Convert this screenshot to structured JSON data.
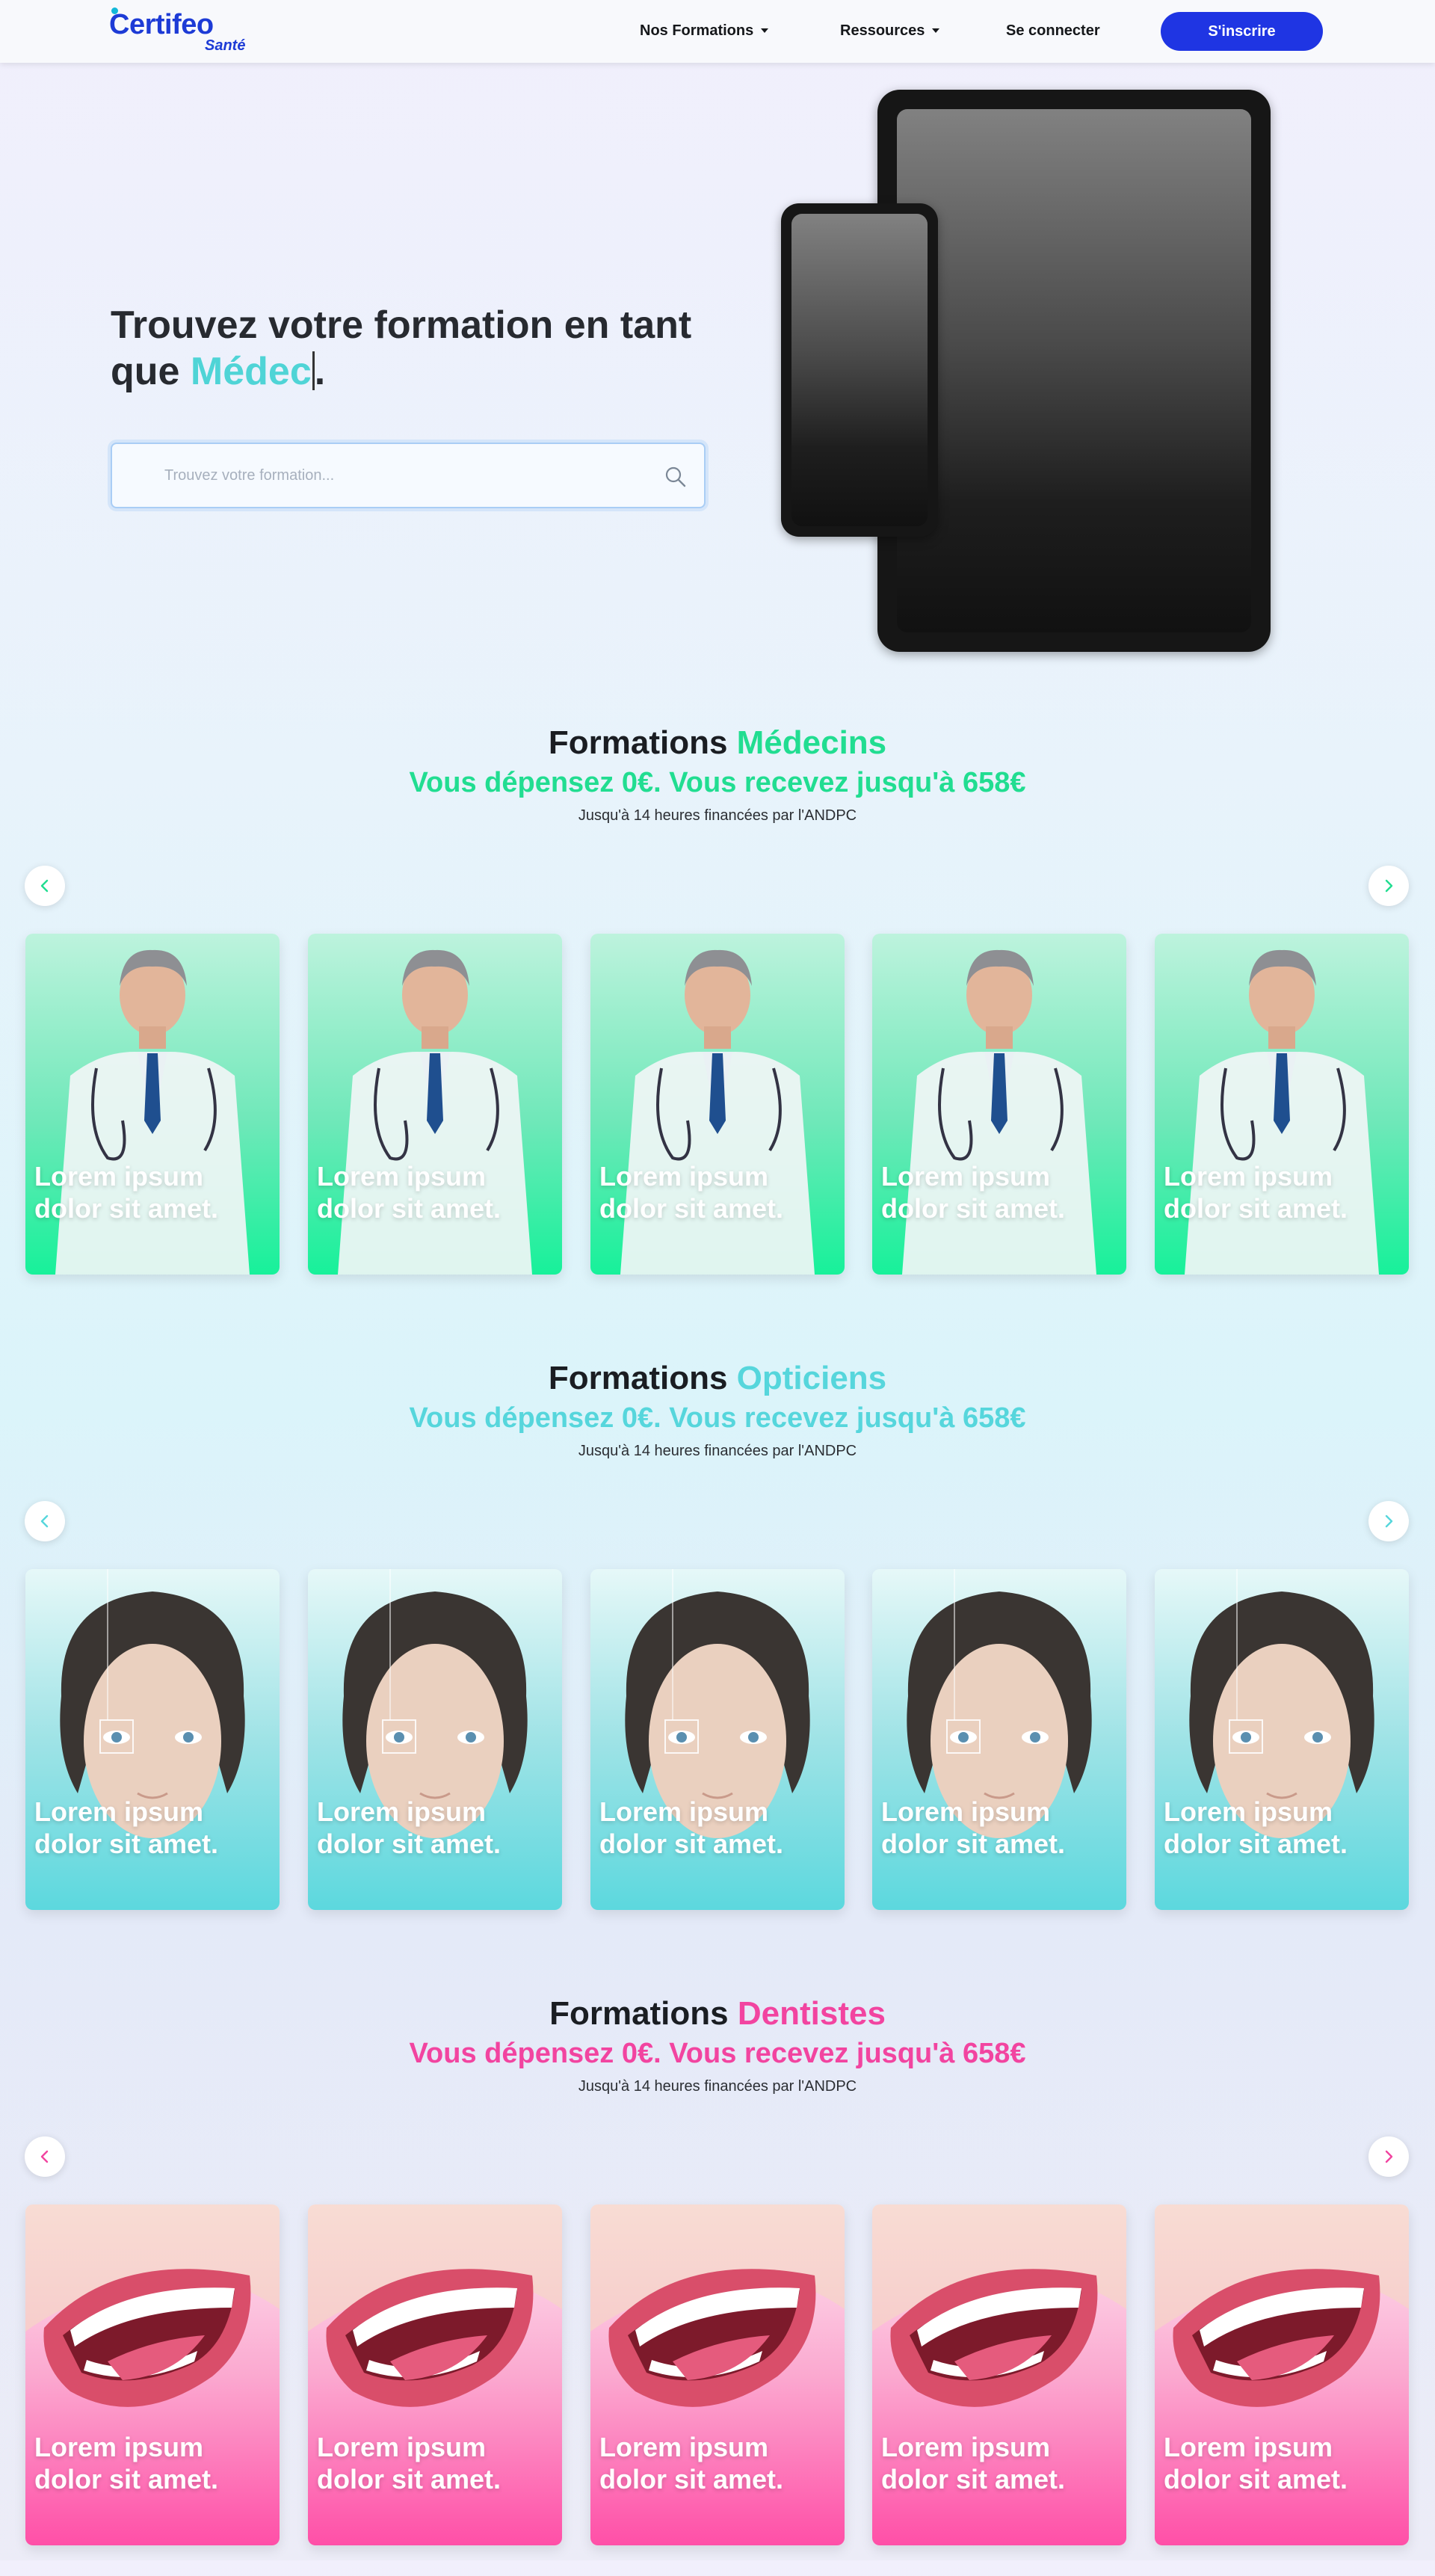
{
  "navbar": {
    "brand": "Certifeo",
    "brand_sub": "Santé",
    "menu": [
      {
        "label": "Nos Formations",
        "dropdown": true
      },
      {
        "label": "Ressources",
        "dropdown": true
      },
      {
        "label": "Se connecter",
        "dropdown": false
      }
    ],
    "signup_label": "S'inscrire"
  },
  "hero": {
    "title_prefix": "Trouvez votre formation en tant que ",
    "title_typed": "Médec",
    "title_suffix": ".",
    "search_placeholder": "Trouvez votre formation..."
  },
  "sections": [
    {
      "title_prefix": "Formations ",
      "title_accent": "Médecins",
      "subtitle": "Vous dépensez 0€. Vous recevez jusqu'à 658€",
      "note": "Jusqu'à 14 heures financées par l'ANDPC",
      "accent_color": "#21dd91",
      "card_theme": "medecins",
      "cards": [
        "Lorem ipsum dolor sit amet.",
        "Lorem ipsum dolor sit amet.",
        "Lorem ipsum dolor sit amet.",
        "Lorem ipsum dolor sit amet.",
        "Lorem ipsum dolor sit amet."
      ]
    },
    {
      "title_prefix": "Formations ",
      "title_accent": "Opticiens",
      "subtitle": "Vous dépensez 0€. Vous recevez jusqu'à 658€",
      "note": "Jusqu'à 14 heures financées par l'ANDPC",
      "accent_color": "#56d6dc",
      "card_theme": "opticiens",
      "cards": [
        "Lorem ipsum dolor sit amet.",
        "Lorem ipsum dolor sit amet.",
        "Lorem ipsum dolor sit amet.",
        "Lorem ipsum dolor sit amet.",
        "Lorem ipsum dolor sit amet."
      ]
    },
    {
      "title_prefix": "Formations ",
      "title_accent": "Dentistes",
      "subtitle": "Vous dépensez 0€. Vous recevez jusqu'à 658€",
      "note": "Jusqu'à 14 heures financées par l'ANDPC",
      "accent_color": "#f244a0",
      "card_theme": "dentistes",
      "cards": [
        "Lorem ipsum dolor sit amet.",
        "Lorem ipsum dolor sit amet.",
        "Lorem ipsum dolor sit amet.",
        "Lorem ipsum dolor sit amet.",
        "Lorem ipsum dolor sit amet."
      ]
    }
  ],
  "icons": {
    "search": "search-icon",
    "prev": "chevron-left-icon",
    "next": "chevron-right-icon",
    "dropdown": "caret-down-icon"
  }
}
